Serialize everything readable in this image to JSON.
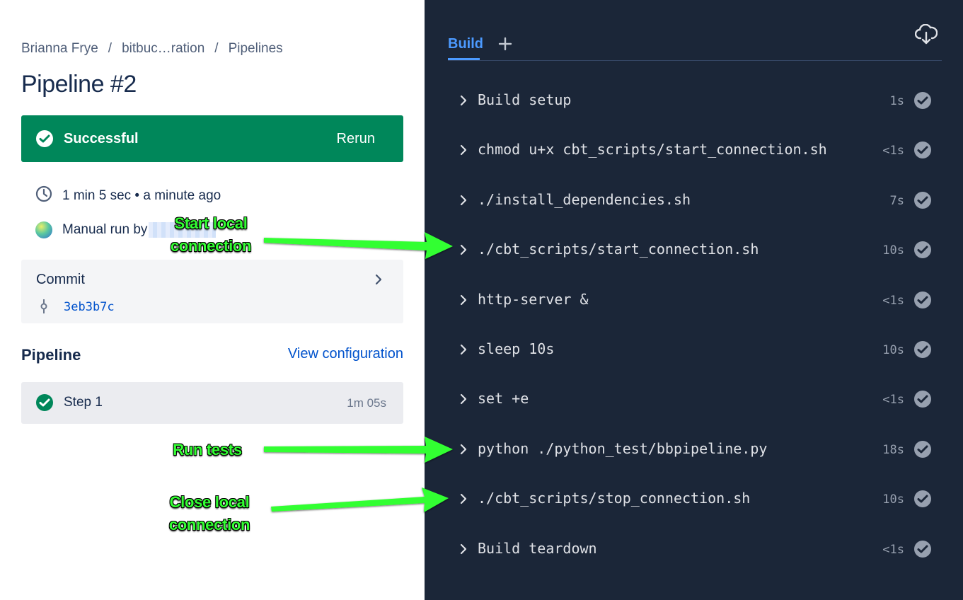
{
  "breadcrumb": {
    "owner": "Brianna Frye",
    "separator": "/",
    "repo": "bitbuc…ration",
    "section": "Pipelines"
  },
  "page_title": "Pipeline #2",
  "status": {
    "label": "Successful",
    "rerun_label": "Rerun",
    "color": "#00875a"
  },
  "run_info": {
    "duration": "1 min 5 sec • a minute ago",
    "trigger": "Manual run by"
  },
  "commit": {
    "title": "Commit",
    "hash": "3eb3b7c"
  },
  "pipeline_section": {
    "title": "Pipeline",
    "view_config_label": "View configuration"
  },
  "steps": [
    {
      "name": "Step 1",
      "time": "1m 05s"
    }
  ],
  "log_panel": {
    "tab_label": "Build",
    "add_tab_icon": "plus-icon",
    "download_icon": "cloud-download-icon",
    "background": "#1b2638",
    "accent": "#4c9aff",
    "rows": [
      {
        "command": "Build setup",
        "duration": "1s"
      },
      {
        "command": "chmod u+x cbt_scripts/start_connection.sh",
        "duration": "<1s"
      },
      {
        "command": "./install_dependencies.sh",
        "duration": "7s"
      },
      {
        "command": "./cbt_scripts/start_connection.sh",
        "duration": "10s"
      },
      {
        "command": "http-server &",
        "duration": "<1s"
      },
      {
        "command": "sleep 10s",
        "duration": "10s"
      },
      {
        "command": "set +e",
        "duration": "<1s"
      },
      {
        "command": "python ./python_test/bbpipeline.py",
        "duration": "18s"
      },
      {
        "command": "./cbt_scripts/stop_connection.sh",
        "duration": "10s"
      },
      {
        "command": "Build teardown",
        "duration": "<1s"
      }
    ]
  },
  "annotations": {
    "start": {
      "line1": "Start local",
      "line2": "connection"
    },
    "run": {
      "line1": "Run tests"
    },
    "close": {
      "line1": "Close local",
      "line2": "connection"
    },
    "color": "#33ff33"
  }
}
